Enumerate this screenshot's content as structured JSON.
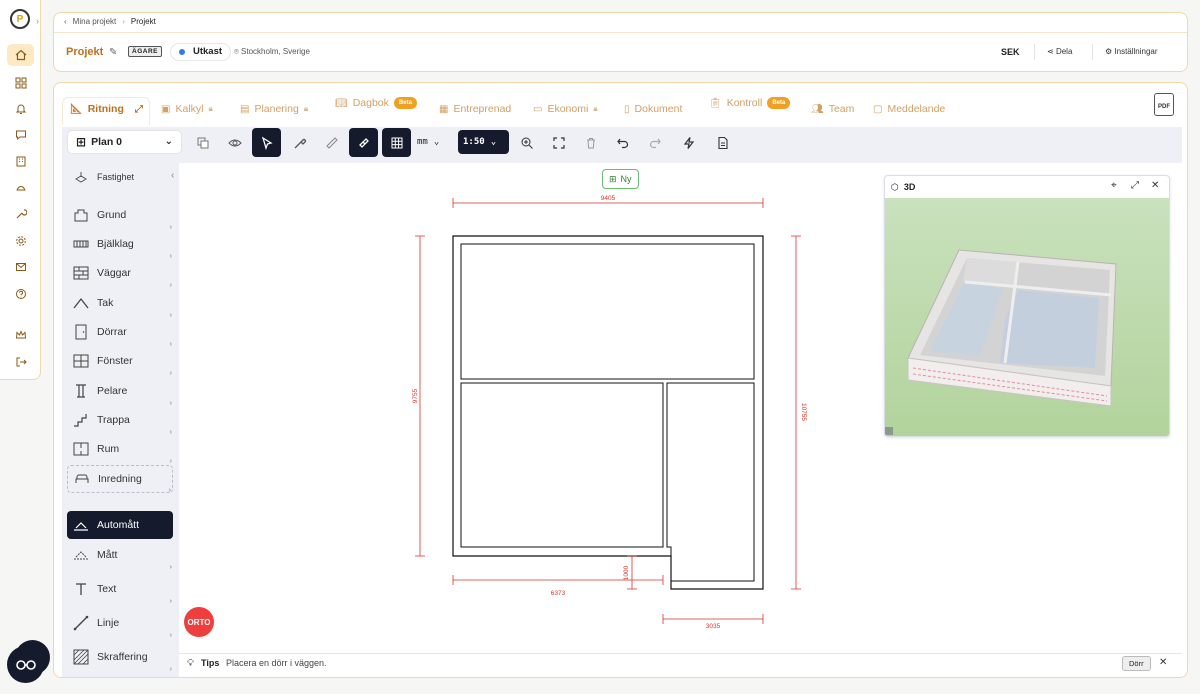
{
  "breadcrumbs": {
    "back": "Mina projekt",
    "current": "Projekt"
  },
  "header": {
    "title": "Projekt",
    "owner_badge": "ÄGARE",
    "status": "Utkast",
    "location": "Stockholm, Sverige",
    "currency": "SEK",
    "share": "Dela",
    "settings": "Inställningar"
  },
  "tabs": [
    {
      "label": "Ritning",
      "icon": "ruler-icon",
      "active": true
    },
    {
      "label": "Kalkyl",
      "icon": "calculator-icon",
      "locked": true
    },
    {
      "label": "Planering",
      "icon": "planning-icon",
      "locked": true
    },
    {
      "label": "Dagbok",
      "icon": "book-icon",
      "badge": "Beta"
    },
    {
      "label": "Entreprenad",
      "icon": "contract-icon"
    },
    {
      "label": "Ekonomi",
      "icon": "wallet-icon",
      "locked": true
    },
    {
      "label": "Dokument",
      "icon": "document-icon"
    },
    {
      "label": "Kontroll",
      "icon": "clipboard-icon",
      "badge": "Beta"
    },
    {
      "label": "Team",
      "icon": "team-icon"
    },
    {
      "label": "Meddelande",
      "icon": "message-icon"
    }
  ],
  "pdf_label": "PDF",
  "toolbar": {
    "plan": "Plan 0",
    "unit": "mm",
    "scale": "1:50"
  },
  "tools": [
    {
      "label": "Fastighet",
      "icon": "property-icon"
    },
    {
      "label": "Grund",
      "icon": "foundation-icon"
    },
    {
      "label": "Bjälklag",
      "icon": "joist-icon"
    },
    {
      "label": "Väggar",
      "icon": "wall-icon"
    },
    {
      "label": "Tak",
      "icon": "roof-icon"
    },
    {
      "label": "Dörrar",
      "icon": "door-icon"
    },
    {
      "label": "Fönster",
      "icon": "window-icon"
    },
    {
      "label": "Pelare",
      "icon": "pillar-icon"
    },
    {
      "label": "Trappa",
      "icon": "stairs-icon"
    },
    {
      "label": "Rum",
      "icon": "room-icon"
    },
    {
      "label": "Inredning",
      "icon": "furniture-icon"
    },
    {
      "label": "Automått",
      "icon": "auto-dimension-icon",
      "active": true
    },
    {
      "label": "Mått",
      "icon": "dimension-icon"
    },
    {
      "label": "Text",
      "icon": "text-icon"
    },
    {
      "label": "Linje",
      "icon": "line-icon"
    },
    {
      "label": "Skraffering",
      "icon": "hatch-icon"
    }
  ],
  "canvas": {
    "new_button": "Ny",
    "orto": "ORTO",
    "dimensions": {
      "top_width": "9405",
      "left_height": "9755",
      "right_height": "10755",
      "bottom_width": "6373",
      "notch_height": "1000",
      "extension_width": "3035"
    }
  },
  "view3d": {
    "title": "3D"
  },
  "tips": {
    "label": "Tips",
    "text": "Placera en dörr i väggen.",
    "button": "Dörr"
  },
  "colors": {
    "accent": "#c0701c",
    "dark": "#151b2c",
    "dimension": "#d9342b",
    "status_dot": "#2f7be8"
  }
}
